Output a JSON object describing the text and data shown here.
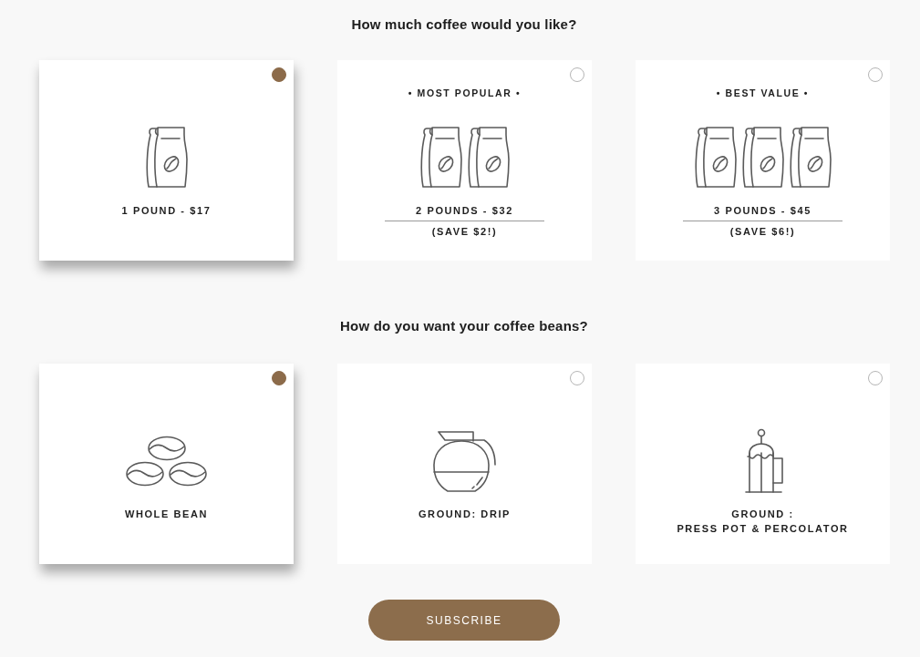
{
  "sections": [
    {
      "heading": "How much coffee would you like?",
      "options": [
        {
          "kind": "single",
          "label": "1 POUND - $17",
          "selected": true
        },
        {
          "kind": "double",
          "badge": "• MOST POPULAR •",
          "label": "2 POUNDS - $32",
          "note": "(SAVE $2!)",
          "selected": false
        },
        {
          "kind": "triple",
          "badge": "• BEST VALUE •",
          "label": "3 POUNDS - $45",
          "note": "(SAVE $6!)",
          "selected": false
        }
      ]
    },
    {
      "heading": "How do you want your coffee beans?",
      "options": [
        {
          "kind": "beans",
          "label": "WHOLE BEAN",
          "selected": true
        },
        {
          "kind": "carafe",
          "label": "GROUND: DRIP",
          "selected": false
        },
        {
          "kind": "press",
          "label": "GROUND :\nPRESS POT & PERCOLATOR",
          "selected": false
        }
      ]
    }
  ],
  "button": {
    "label": "SUBSCRIBE"
  }
}
